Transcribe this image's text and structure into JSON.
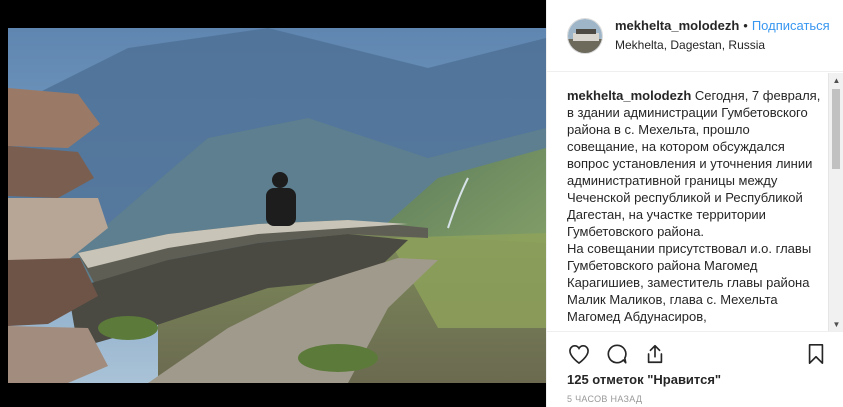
{
  "post": {
    "username": "mekhelta_molodezh",
    "separator": "•",
    "follow_label": "Подписаться",
    "location": "Mekhelta, Dagestan, Russia"
  },
  "caption": {
    "username": "mekhelta_molodezh",
    "paragraph1": "Сегодня, 7 февраля, в здании администрации Гумбетовского района в с. Мехельта, прошло совещание, на котором обсуждался вопрос установления и уточнения линии административной границы между Чеченской республикой и Республикой Дагестан, на участке территории Гумбетовского района.",
    "paragraph2": "На совещании присутствовал и.о. главы Гумбетовского района Магомед Карагишиев, заместитель главы района Малик Маликов, глава с. Мехельта Магомед Абдунасиров,"
  },
  "stats": {
    "likes": "125 отметок \"Нравится\"",
    "time_ago": "5 часов назад"
  },
  "icons": {
    "like": "heart-icon",
    "comment": "comment-icon",
    "share": "share-icon",
    "save": "bookmark-icon"
  },
  "colors": {
    "accent": "#3897f0",
    "text": "#262626",
    "muted": "#999999"
  }
}
